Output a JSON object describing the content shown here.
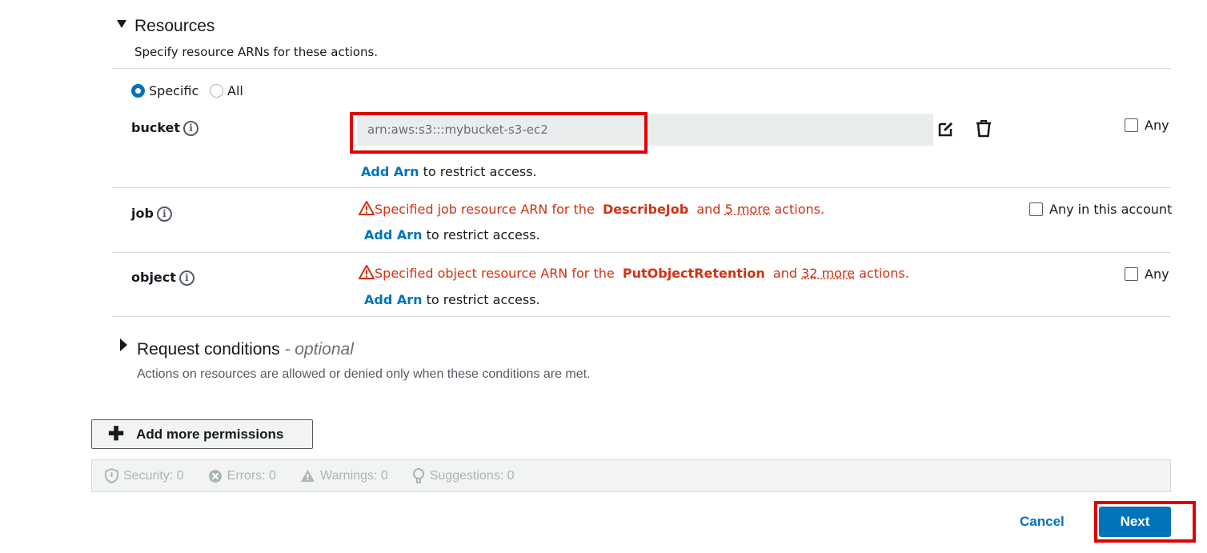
{
  "resources": {
    "title": "Resources",
    "description": "Specify resource ARNs for these actions.",
    "scope_options": [
      {
        "label": "Specific",
        "checked": true
      },
      {
        "label": "All",
        "checked": false
      }
    ],
    "bucket": {
      "label": "bucket",
      "arn_value": "arn:aws:s3:::mybucket-s3-ec2",
      "add_arn": "Add Arn",
      "restrict_text": "to restrict access.",
      "any_label": "Any"
    },
    "job": {
      "label": "job",
      "warning_prefix": "Specified job resource ARN for the",
      "action": "DescribeJob",
      "and_text": "and",
      "more_link": "5 more",
      "suffix": "actions.",
      "add_arn": "Add Arn",
      "restrict_text": "to restrict access.",
      "any_label": "Any in this account"
    },
    "object": {
      "label": "object",
      "warning_prefix": "Specified object resource ARN for the",
      "action": "PutObjectRetention",
      "and_text": "and",
      "more_link": "32 more",
      "suffix": "actions.",
      "add_arn": "Add Arn",
      "restrict_text": "to restrict access.",
      "any_label": "Any"
    }
  },
  "request_conditions": {
    "title": "Request conditions",
    "optional": "- optional",
    "description": "Actions on resources are allowed or denied only when these conditions are met."
  },
  "add_permissions_label": "Add more permissions",
  "status": {
    "security": "Security: 0",
    "errors": "Errors: 0",
    "warnings": "Warnings: 0",
    "suggestions": "Suggestions: 0"
  },
  "footer": {
    "cancel": "Cancel",
    "next": "Next"
  },
  "colors": {
    "link": "#0073bb",
    "warning": "#d13212",
    "highlight_box": "#e00000",
    "primary_button": "#0073bb"
  }
}
